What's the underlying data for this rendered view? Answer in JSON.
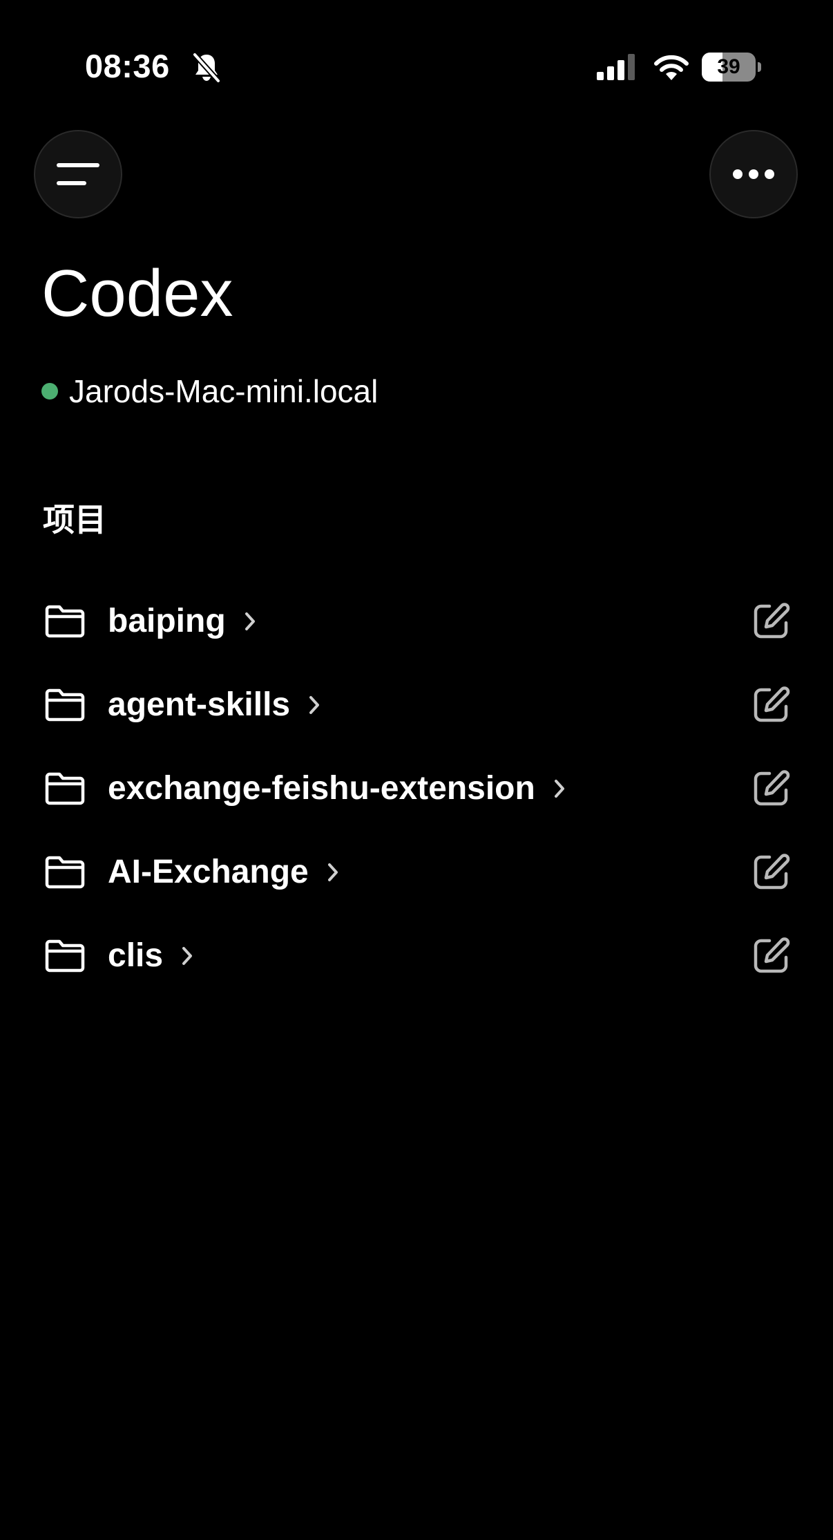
{
  "status_bar": {
    "time": "08:36",
    "battery_level": "39",
    "battery_fraction": 0.39,
    "icons": [
      "bell-slash-icon",
      "cellular-signal-icon",
      "wifi-icon",
      "battery-icon"
    ]
  },
  "header": {
    "menu_icon": "menu-icon",
    "more_icon": "more-icon",
    "title": "Codex",
    "host": {
      "name": "Jarods-Mac-mini.local",
      "status_color": "#4caf71"
    }
  },
  "projects": {
    "section_title": "项目",
    "items": [
      {
        "name": "baiping"
      },
      {
        "name": "agent-skills"
      },
      {
        "name": "exchange-feishu-extension"
      },
      {
        "name": "AI-Exchange"
      },
      {
        "name": "clis"
      }
    ]
  },
  "colors": {
    "background": "#000000",
    "text": "#ffffff",
    "button_bg": "#131313",
    "muted_icon": "#b9b9b9",
    "online": "#4caf71"
  }
}
